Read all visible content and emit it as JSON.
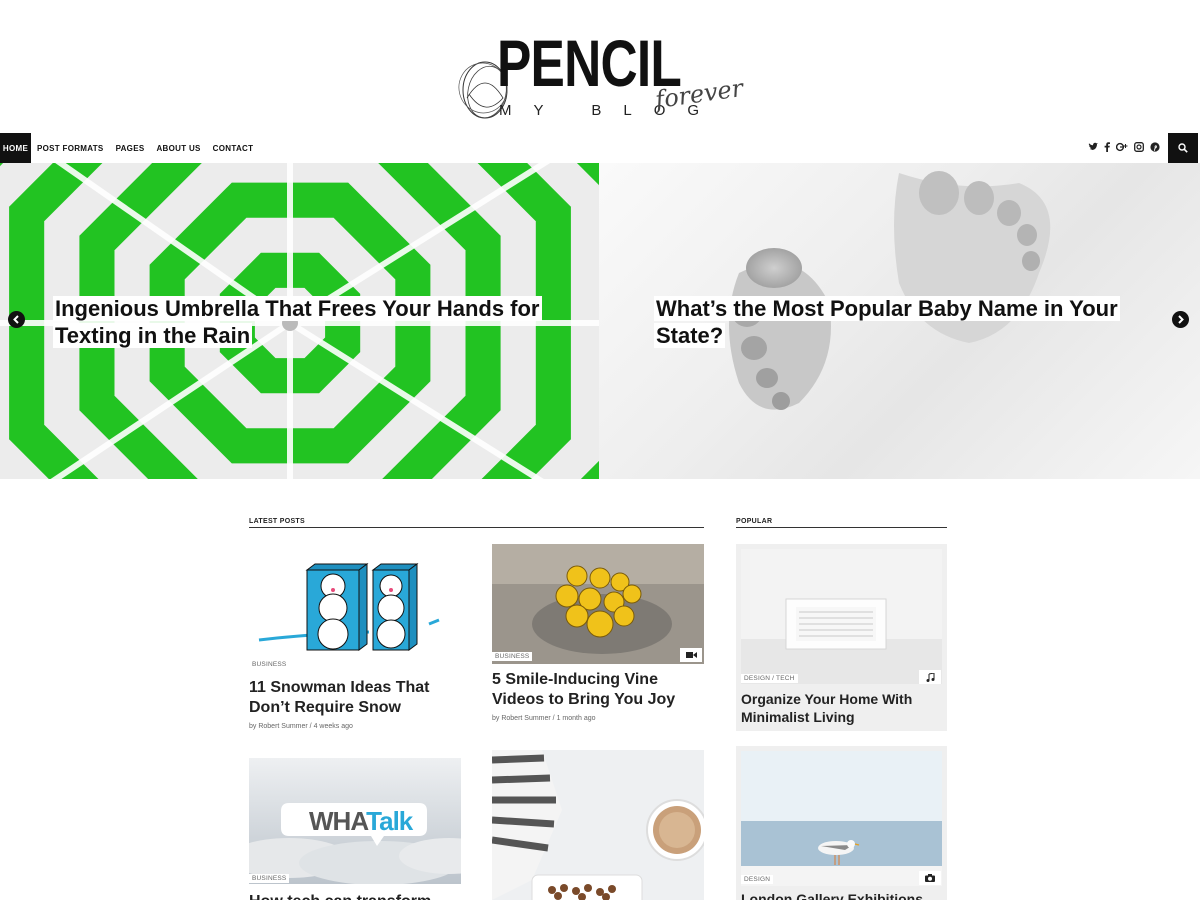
{
  "site": {
    "logo_word": "PENCIL",
    "logo_sub": "MY BLOG",
    "logo_script": "forever"
  },
  "nav": {
    "items": [
      {
        "label": "HOME"
      },
      {
        "label": "POST FORMATS"
      },
      {
        "label": "PAGES"
      },
      {
        "label": "ABOUT US"
      },
      {
        "label": "CONTACT"
      }
    ],
    "social_icons": [
      "twitter-icon",
      "facebook-icon",
      "google-plus-icon",
      "instagram-icon",
      "pinterest-icon"
    ],
    "search_icon": "search-icon"
  },
  "slider": {
    "slides": [
      {
        "title": "Ingenious Umbrella That Frees Your Hands for Texting in the Rain"
      },
      {
        "title": "What’s the Most Popular Baby Name in Your State?"
      }
    ],
    "prev_icon": "chevron-left-icon",
    "next_icon": "chevron-right-icon"
  },
  "latest": {
    "heading": "LATEST POSTS",
    "posts": [
      {
        "category": "BUSINESS",
        "title": "11 Snowman Ideas That Don’t Require Snow",
        "meta": "by Robert Summer / 4 weeks ago"
      },
      {
        "category": "BUSINESS",
        "title": "5 Smile-Inducing Vine Videos to Bring You Joy",
        "meta": "by Robert Summer / 1 month ago",
        "format_icon": "video-icon"
      },
      {
        "category": "BUSINESS",
        "title": "How tech can transform",
        "image_text_1": "WHA",
        "image_text_2": "Talk"
      },
      {
        "category": "",
        "title": ""
      }
    ]
  },
  "popular": {
    "heading": "POPULAR",
    "posts": [
      {
        "category": "DESIGN / TECH",
        "title": "Organize Your Home With Minimalist Living",
        "format_icon": "music-icon"
      },
      {
        "category": "DESIGN",
        "title": "London Gallery Exhibitions",
        "format_icon": "camera-icon"
      }
    ]
  },
  "colors": {
    "accent": "#111111",
    "umbrella_green": "#22c322",
    "text": "#222222",
    "muted": "#666666"
  }
}
